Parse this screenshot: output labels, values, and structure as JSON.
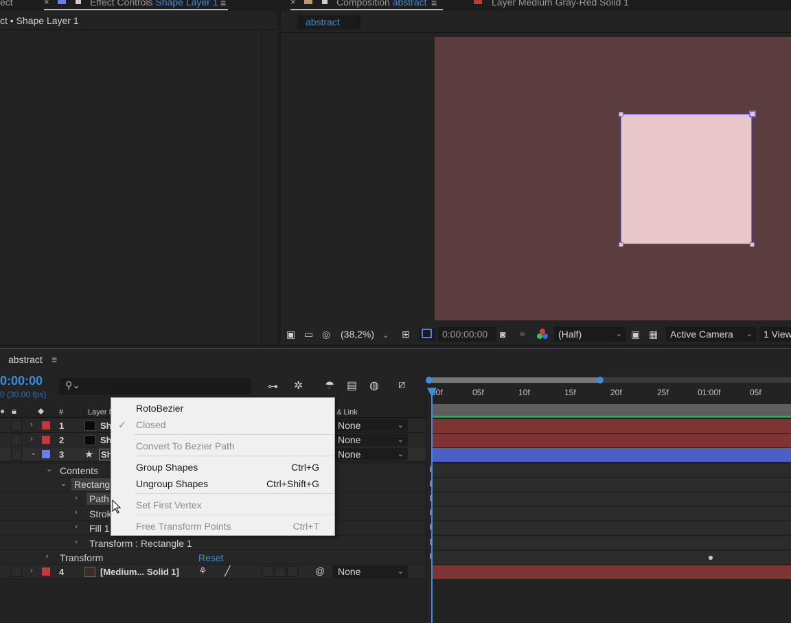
{
  "effect_panel": {
    "tab_prefix": "Effect Controls",
    "tab_layer": "Shape Layer 1",
    "breadcrumb": "ct • Shape Layer 1",
    "left_tab_fragment": "ect"
  },
  "composition_panel": {
    "tab_prefix": "Composition",
    "tab_name": "abstract",
    "layer_tab": "Layer  Medium Gray-Red Solid 1",
    "subtab": "abstract"
  },
  "viewer_bar": {
    "zoom": "(38,2%)",
    "timecode": "0:00:00:00",
    "resolution": "(Half)",
    "camera": "Active Camera",
    "views": "1 View"
  },
  "timeline": {
    "comp_name": "abstract",
    "timecode": "0:00:00",
    "fps": "0 (30.00 fps)",
    "columns": {
      "number": "#",
      "layer_name": "Layer N",
      "parent": "t & Link"
    },
    "ruler_ticks": [
      "00f",
      "05f",
      "10f",
      "15f",
      "20f",
      "25f",
      "01:00f",
      "05f"
    ],
    "layers": [
      {
        "num": "1",
        "name": "Sh",
        "parent": "None",
        "label_color": "#c4383a",
        "expanded": false
      },
      {
        "num": "2",
        "name": "Sh",
        "parent": "None",
        "label_color": "#c4383a",
        "expanded": false
      },
      {
        "num": "3",
        "name": "Sh",
        "parent": "None",
        "label_color": "#6d7fe0",
        "expanded": true
      },
      {
        "num": "4",
        "name": "[Medium... Solid 1]",
        "parent": "None",
        "label_color": "#c4383a",
        "expanded": false
      }
    ],
    "properties": {
      "contents": "Contents",
      "rectangle": "Rectangl",
      "path": "Path",
      "stroke": "Strok",
      "fill": "Fill 1",
      "transform_rect": "Transform : Rectangle 1",
      "transform": "Transform",
      "reset": "Reset"
    }
  },
  "context_menu": {
    "items": [
      {
        "label": "RotoBezier",
        "shortcut": "",
        "enabled": true,
        "checked": false
      },
      {
        "label": "Closed",
        "shortcut": "",
        "enabled": false,
        "checked": true
      },
      {
        "label": "Convert To Bezier Path",
        "shortcut": "",
        "enabled": false,
        "checked": false
      },
      {
        "label": "Group Shapes",
        "shortcut": "Ctrl+G",
        "enabled": true,
        "checked": false
      },
      {
        "label": "Ungroup Shapes",
        "shortcut": "Ctrl+Shift+G",
        "enabled": true,
        "checked": false
      },
      {
        "label": "Set First Vertex",
        "shortcut": "",
        "enabled": false,
        "checked": false
      },
      {
        "label": "Free Transform Points",
        "shortcut": "Ctrl+T",
        "enabled": false,
        "checked": false
      }
    ]
  },
  "colors": {
    "accent_blue": "#3b8dde",
    "comp_background": "#5b3d40",
    "shape_fill": "#e8c6c9",
    "selection": "#6f72e6",
    "red_track": "#7f3434",
    "blue_track": "#4c5fc4"
  }
}
